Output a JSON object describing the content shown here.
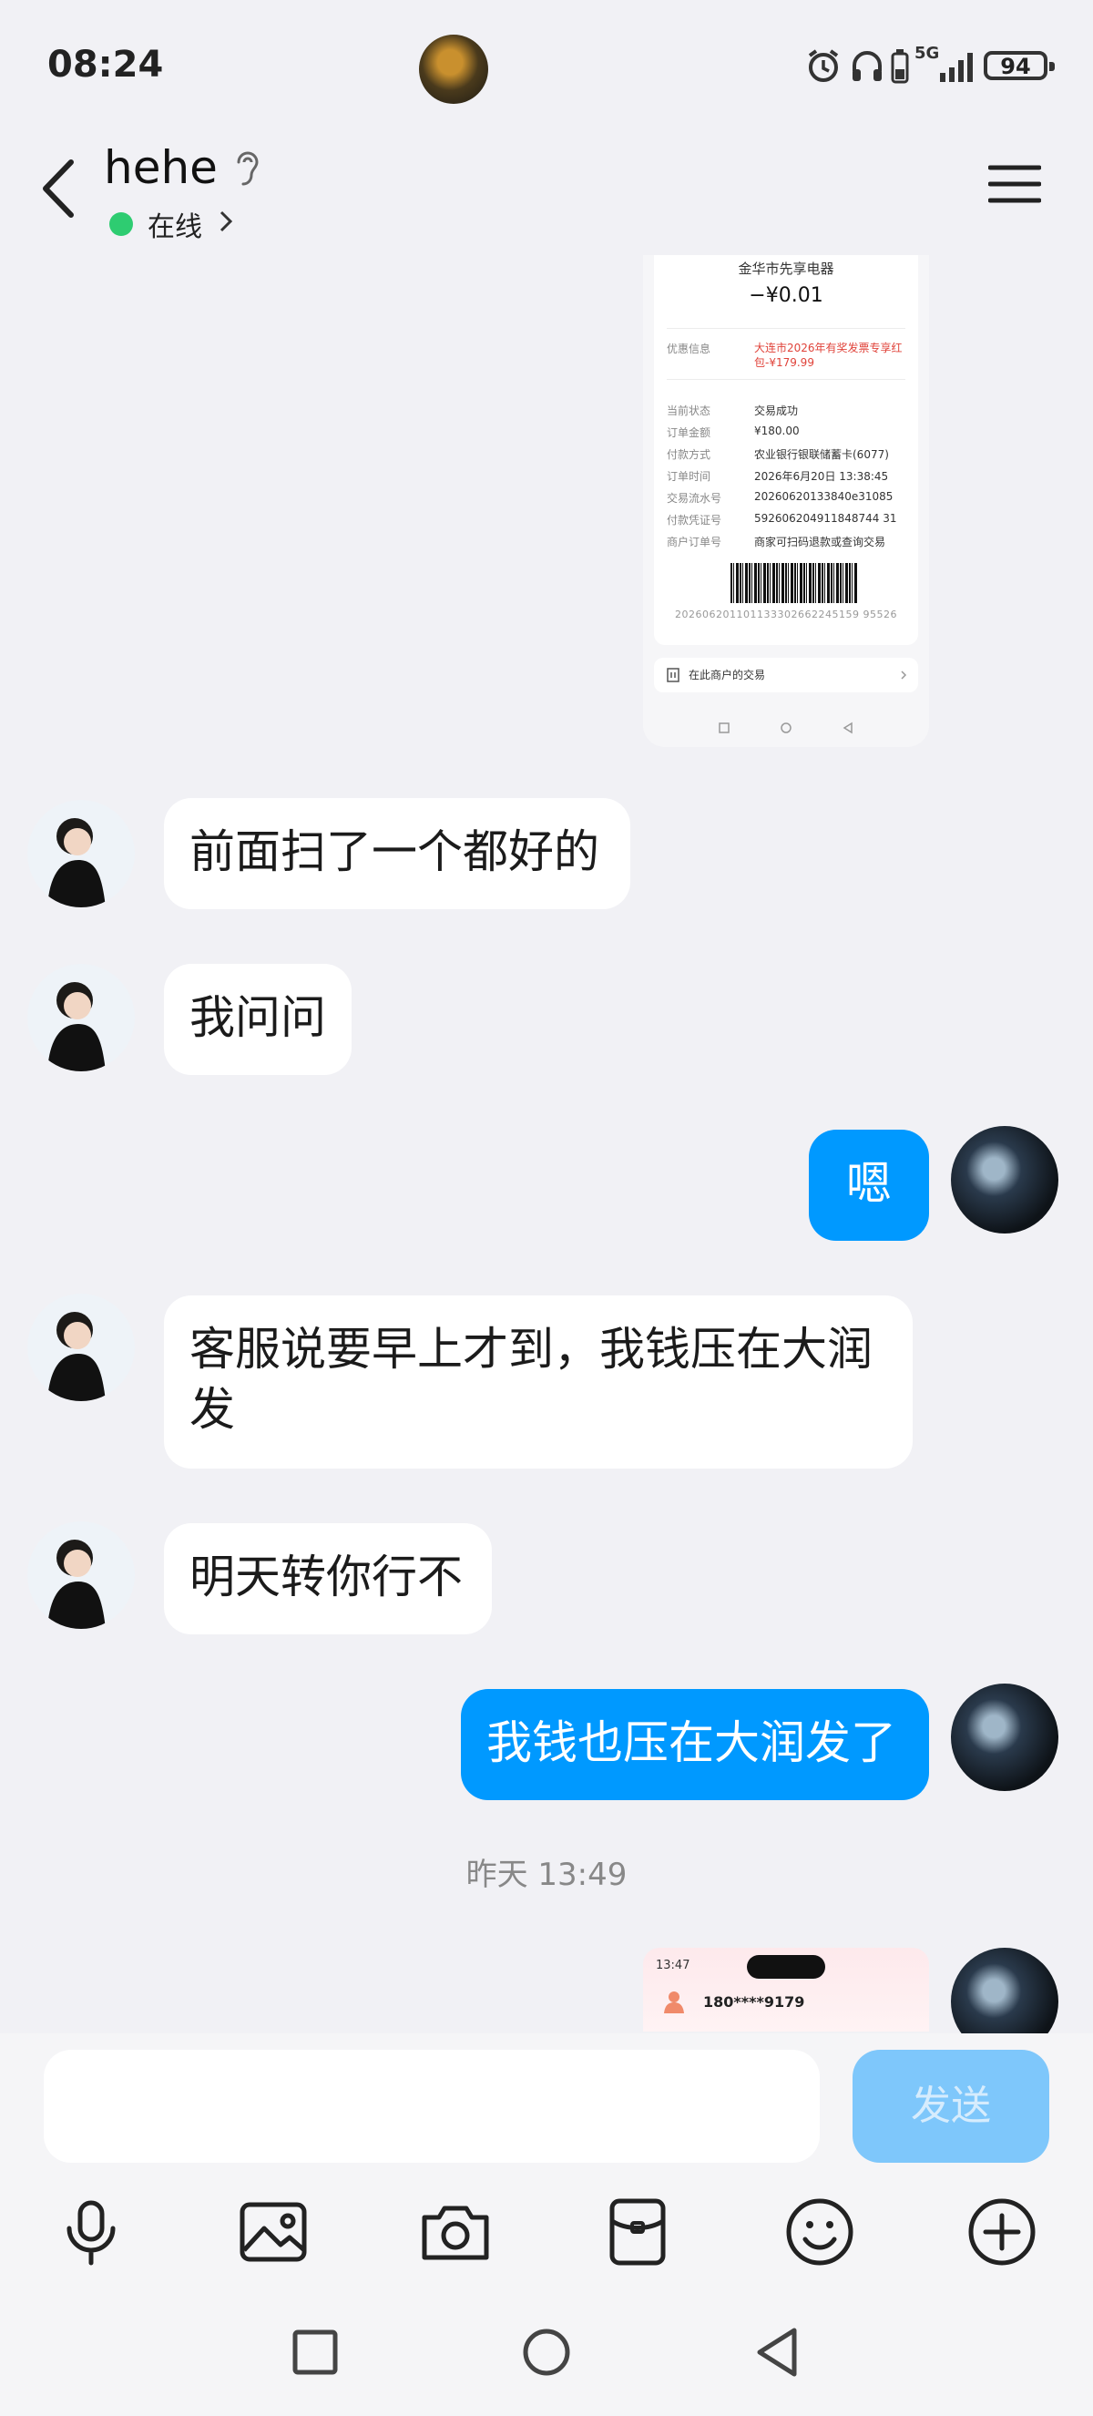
{
  "status_bar": {
    "time": "08:24",
    "network": "5G",
    "battery": "94"
  },
  "header": {
    "contact_name": "hehe",
    "status": "在线"
  },
  "receipt": {
    "merchant": "金华市先享电器",
    "amount": "−¥0.01",
    "discount_label": "优惠信息",
    "discount_value": "大连市2026年有奖发票专享红包-¥179.99",
    "rows": [
      {
        "k": "当前状态",
        "v": "交易成功"
      },
      {
        "k": "订单金额",
        "v": "¥180.00"
      },
      {
        "k": "付款方式",
        "v": "农业银行银联储蓄卡(6077)"
      },
      {
        "k": "订单时间",
        "v": "2026年6月20日 13:38:45"
      },
      {
        "k": "交易流水号",
        "v": "20260620133840e31085"
      },
      {
        "k": "付款凭证号",
        "v": "592606204911848744 31"
      },
      {
        "k": "商户订单号",
        "v": "商家可扫码退款或查询交易"
      }
    ],
    "barcode_number": "202606201101133302662245159 95526",
    "merchant_link": "在此商户的交易"
  },
  "messages": [
    {
      "side": "left",
      "text": "前面扫了一个都好的"
    },
    {
      "side": "left",
      "text": "我问问"
    },
    {
      "side": "right",
      "text": "嗯"
    },
    {
      "side": "left",
      "text": "客服说要早上才到，我钱压在大润发"
    },
    {
      "side": "left",
      "text": "明天转你行不"
    },
    {
      "side": "right",
      "text": "我钱也压在大润发了"
    }
  ],
  "timestamp": "昨天 13:49",
  "preview": {
    "time": "13:47",
    "phone": "180****9179"
  },
  "input": {
    "placeholder": "",
    "send_label": "发送"
  },
  "toolbar": [
    "mic-icon",
    "image-icon",
    "camera-icon",
    "red-packet-icon",
    "emoji-icon",
    "plus-icon"
  ],
  "colors": {
    "accent": "#0099ff",
    "send_disabled": "#7ec7fb",
    "online": "#2ecc71",
    "background": "#f1f1f5"
  }
}
